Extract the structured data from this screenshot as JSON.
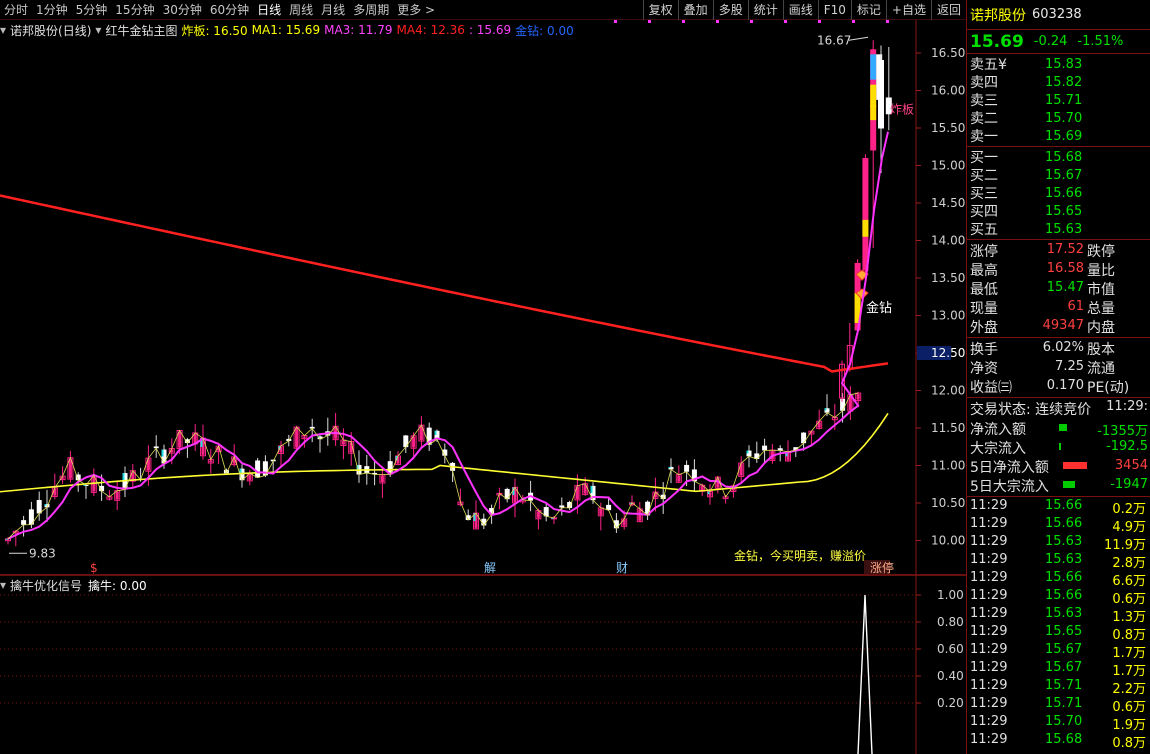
{
  "toolbar": {
    "timeframes": [
      "分时",
      "1分钟",
      "5分钟",
      "15分钟",
      "30分钟",
      "60分钟",
      "日线",
      "周线",
      "月线",
      "多周期",
      "更多 >"
    ],
    "active_timeframe": "日线",
    "buttons": [
      "复权",
      "叠加",
      "多股",
      "统计",
      "画线",
      "F10",
      "标记",
      "+自选",
      "返回"
    ]
  },
  "legend": {
    "title": "诺邦股份(日线)",
    "indicator": "红牛金钻主图",
    "items": [
      {
        "text": "炸板: 16.50",
        "color": "#ffff00"
      },
      {
        "text": "MA1: 15.69",
        "color": "#ffff00"
      },
      {
        "text": "MA3: 11.79",
        "color": "#ff44ff"
      },
      {
        "text": "MA4: 12.36",
        "color": "#ff2020"
      },
      {
        "text": ": 15.69",
        "color": "#ff44ff"
      },
      {
        "text": "金钻: 0.00",
        "color": "#2266ff"
      }
    ]
  },
  "sub_legend": {
    "title": "擒牛优化信号",
    "value": "擒牛: 0.00"
  },
  "main_axis": {
    "ticks": [
      "16.50",
      "16.00",
      "15.50",
      "15.00",
      "14.50",
      "14.00",
      "13.50",
      "13.00",
      "12.50",
      "12.00",
      "11.50",
      "11.00",
      "10.50",
      "10.00"
    ],
    "highlight": "12.50"
  },
  "sub_axis": {
    "ticks": [
      "1.00",
      "0.80",
      "0.60",
      "0.40",
      "0.20"
    ]
  },
  "annotations": {
    "high": "16.67",
    "low": "9.83",
    "jinzuan": "金钻",
    "zhaban": "炸板",
    "bottom_text": "金钻，今买明卖，赚溢价",
    "markers": [
      "$",
      "解",
      "财",
      "涨停"
    ]
  },
  "chart_data": {
    "type": "candlestick",
    "symbol": "诺邦股份",
    "period": "日线",
    "ylim": [
      9.8,
      16.7
    ],
    "high_label": 16.67,
    "low_label": 9.83,
    "series": [
      {
        "name": "MA1",
        "color": "#ffff00",
        "value": 15.69
      },
      {
        "name": "MA3",
        "color": "#ff44ff",
        "value": 11.79
      },
      {
        "name": "MA4",
        "color": "#ff2020",
        "value": 12.36
      }
    ],
    "sub_chart": {
      "name": "擒牛",
      "ylim": [
        0,
        1
      ],
      "last_value": 0.0,
      "spike_value": 1.0
    }
  },
  "sidebar": {
    "name": "诺邦股份",
    "code": "603238",
    "price": "15.69",
    "change": "-0.24",
    "pct": "-1.51%",
    "asks": [
      {
        "label": "卖五¥",
        "price": "15.83"
      },
      {
        "label": "卖四",
        "price": "15.82"
      },
      {
        "label": "卖三",
        "price": "15.71"
      },
      {
        "label": "卖二",
        "price": "15.70"
      },
      {
        "label": "卖一",
        "price": "15.69"
      }
    ],
    "bids": [
      {
        "label": "买一",
        "price": "15.68"
      },
      {
        "label": "买二",
        "price": "15.67"
      },
      {
        "label": "买三",
        "price": "15.66"
      },
      {
        "label": "买四",
        "price": "15.65"
      },
      {
        "label": "买五",
        "price": "15.63"
      }
    ],
    "stats1": [
      {
        "l1": "涨停",
        "v": "17.52",
        "c": "#ff4040",
        "l2": "跌停"
      },
      {
        "l1": "最高",
        "v": "16.58",
        "c": "#ff4040",
        "l2": "量比"
      },
      {
        "l1": "最低",
        "v": "15.47",
        "c": "#00e000",
        "l2": "市值"
      },
      {
        "l1": "现量",
        "v": "61",
        "c": "#ff4040",
        "l2": "总量"
      },
      {
        "l1": "外盘",
        "v": "49347",
        "c": "#ff4040",
        "l2": "内盘"
      }
    ],
    "stats2": [
      {
        "l1": "换手",
        "v": "6.02%",
        "c": "#e0e0e0",
        "l2": "股本"
      },
      {
        "l1": "净资",
        "v": "7.25",
        "c": "#e0e0e0",
        "l2": "流通"
      },
      {
        "l1": "收益㈢",
        "v": "0.170",
        "c": "#e0e0e0",
        "l2": "PE(动)"
      }
    ],
    "trade_status": "交易状态: 连续竞价",
    "trade_time": "11:29:",
    "flows": [
      {
        "label": "净流入额",
        "value": "-1355万",
        "barColor": "#00cc00",
        "barWidth": 8,
        "barLeft": 92,
        "vc": "#00e000"
      },
      {
        "label": "大宗流入",
        "value": "-192.5",
        "barColor": "#00cc00",
        "barWidth": 2,
        "barLeft": 92,
        "vc": "#00e000"
      },
      {
        "label": "5日净流入额",
        "value": "3454",
        "barColor": "#ff3030",
        "barWidth": 24,
        "barLeft": 96,
        "vc": "#ff4040"
      },
      {
        "label": "5日大宗流入",
        "value": "-1947",
        "barColor": "#00cc00",
        "barWidth": 12,
        "barLeft": 96,
        "vc": "#00e000"
      }
    ],
    "ticks": [
      {
        "t": "11:29",
        "p": "15.66",
        "v": "0.2万"
      },
      {
        "t": "11:29",
        "p": "15.66",
        "v": "4.9万"
      },
      {
        "t": "11:29",
        "p": "15.63",
        "v": "11.9万"
      },
      {
        "t": "11:29",
        "p": "15.63",
        "v": "2.8万"
      },
      {
        "t": "11:29",
        "p": "15.66",
        "v": "6.6万"
      },
      {
        "t": "11:29",
        "p": "15.66",
        "v": "0.6万"
      },
      {
        "t": "11:29",
        "p": "15.63",
        "v": "1.3万"
      },
      {
        "t": "11:29",
        "p": "15.65",
        "v": "0.8万"
      },
      {
        "t": "11:29",
        "p": "15.67",
        "v": "1.7万"
      },
      {
        "t": "11:29",
        "p": "15.67",
        "v": "1.7万"
      },
      {
        "t": "11:29",
        "p": "15.71",
        "v": "2.2万"
      },
      {
        "t": "11:29",
        "p": "15.71",
        "v": "0.6万"
      },
      {
        "t": "11:29",
        "p": "15.70",
        "v": "1.9万"
      },
      {
        "t": "11:29",
        "p": "15.68",
        "v": "0.8万"
      }
    ]
  }
}
